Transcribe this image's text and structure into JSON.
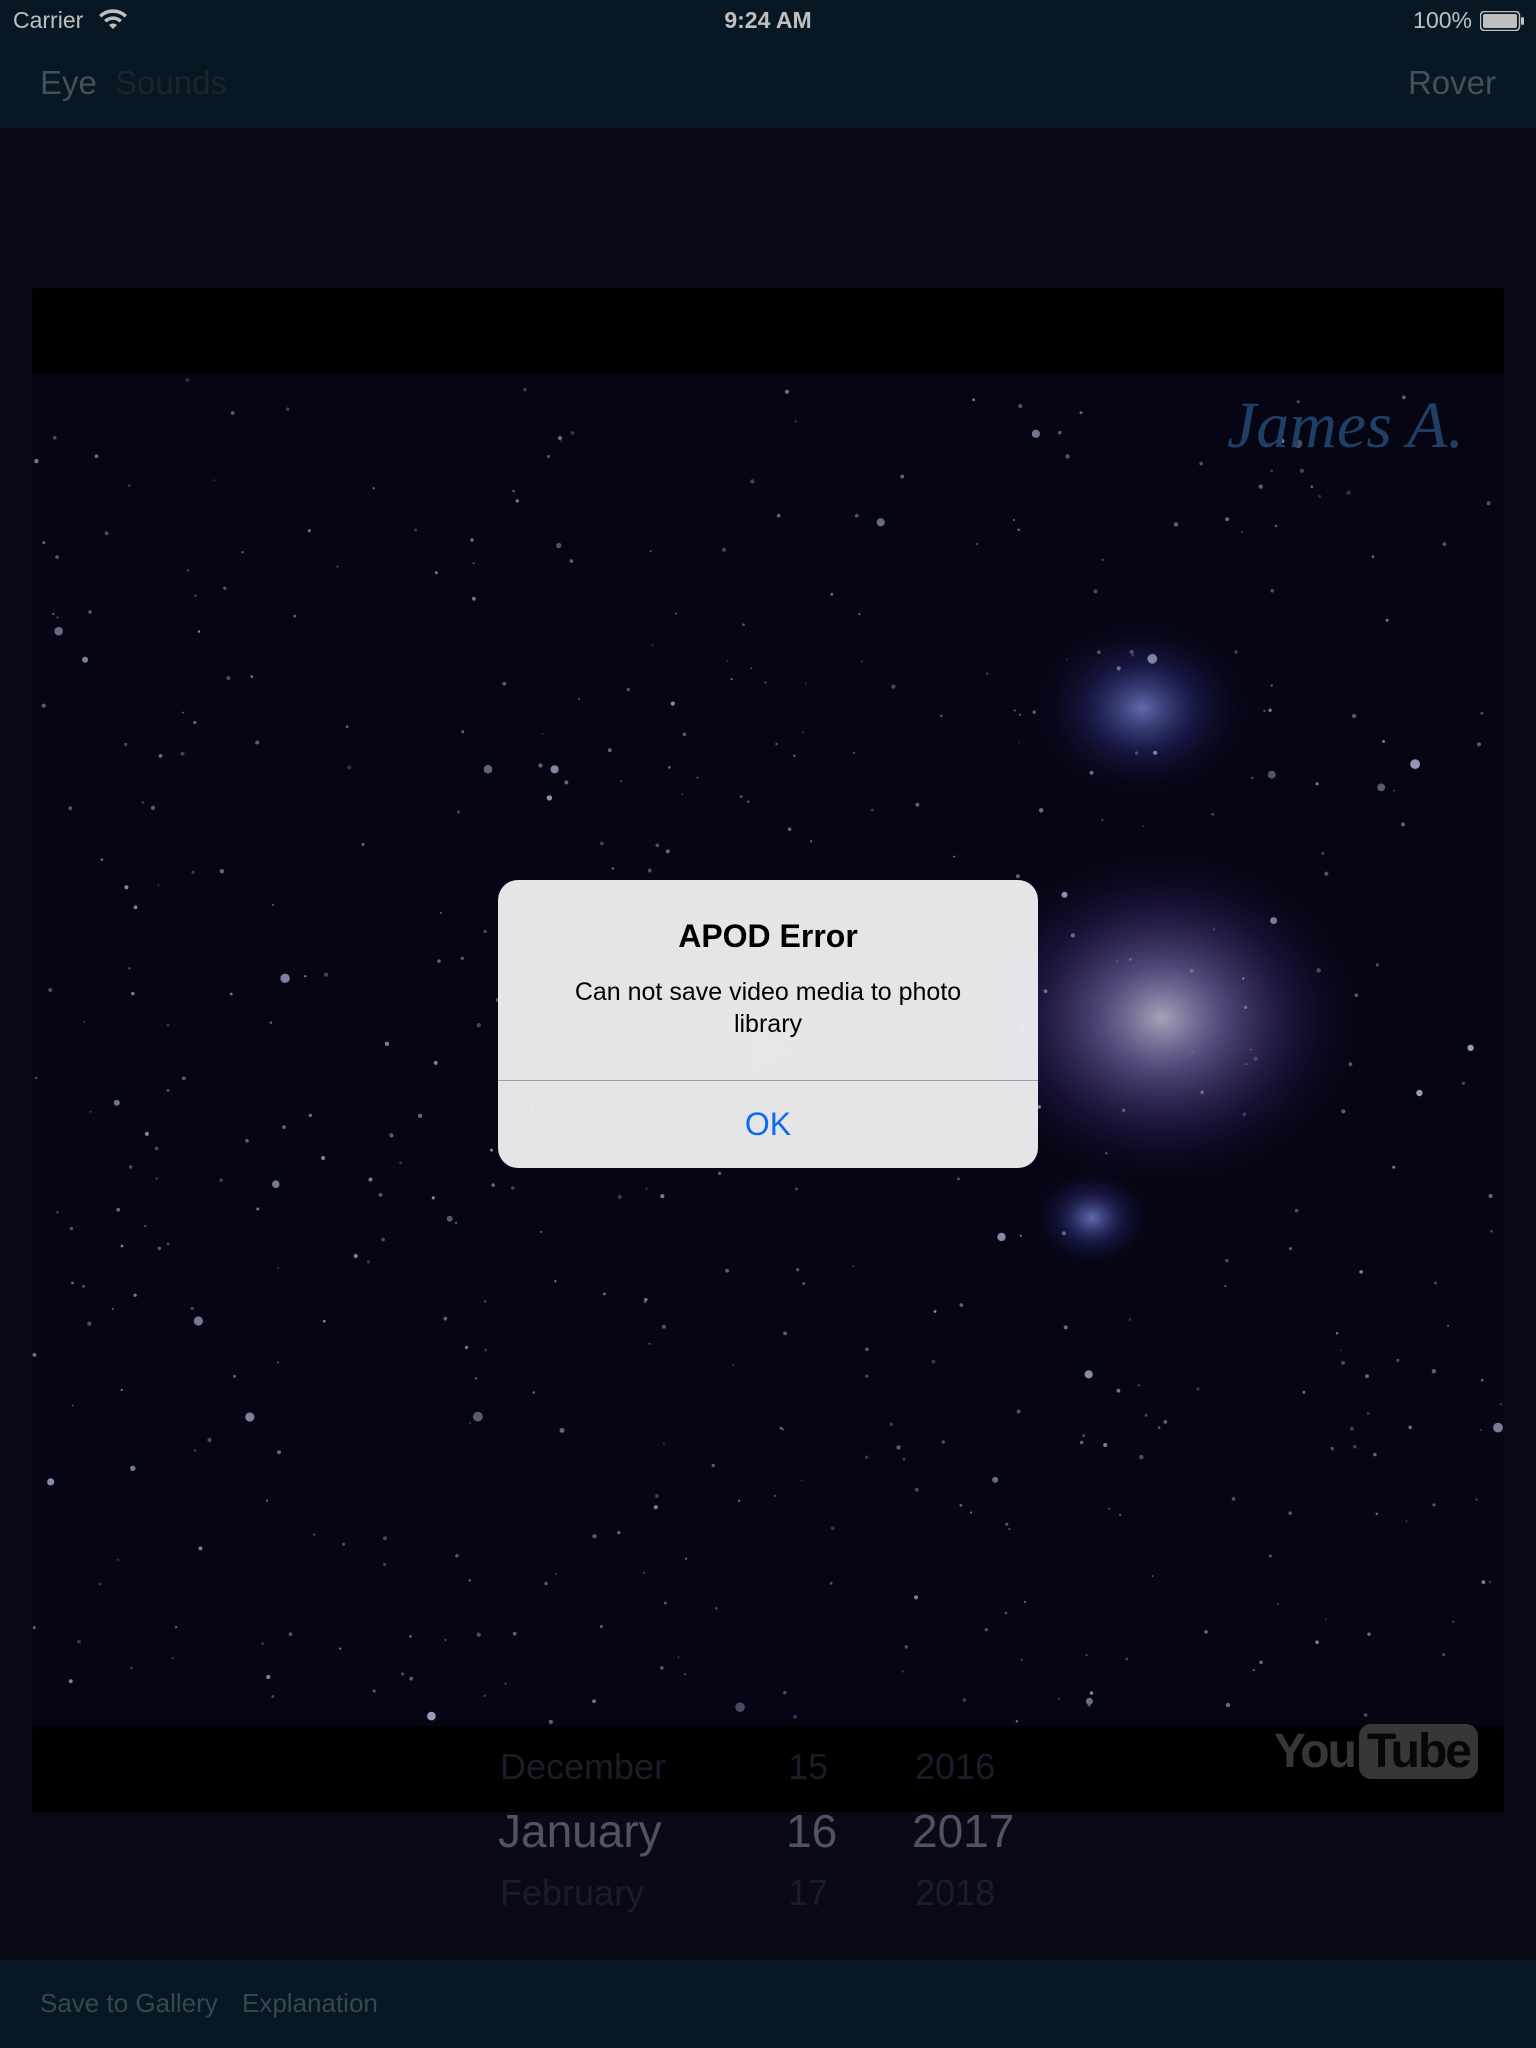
{
  "status_bar": {
    "carrier": "Carrier",
    "time": "9:24 AM",
    "battery": "100%"
  },
  "nav": {
    "left_items": [
      "Eye",
      "Sounds"
    ],
    "right_item": "Rover"
  },
  "video": {
    "credit_text": "James A.",
    "logo_you": "You",
    "logo_tube": "Tube"
  },
  "date_picker": {
    "months": [
      "December",
      "January",
      "February"
    ],
    "days": [
      "15",
      "16",
      "17"
    ],
    "years": [
      "2016",
      "2017",
      "2018"
    ],
    "selected_index": 1
  },
  "toolbar": {
    "save_label": "Save to Gallery",
    "explanation_label": "Explanation"
  },
  "alert": {
    "title": "APOD Error",
    "message": "Can not save video media to photo library",
    "ok_label": "OK"
  },
  "colors": {
    "bar_background": "#0a2131",
    "alert_action": "#0a6cf0",
    "video_credit": "#2a5486"
  }
}
